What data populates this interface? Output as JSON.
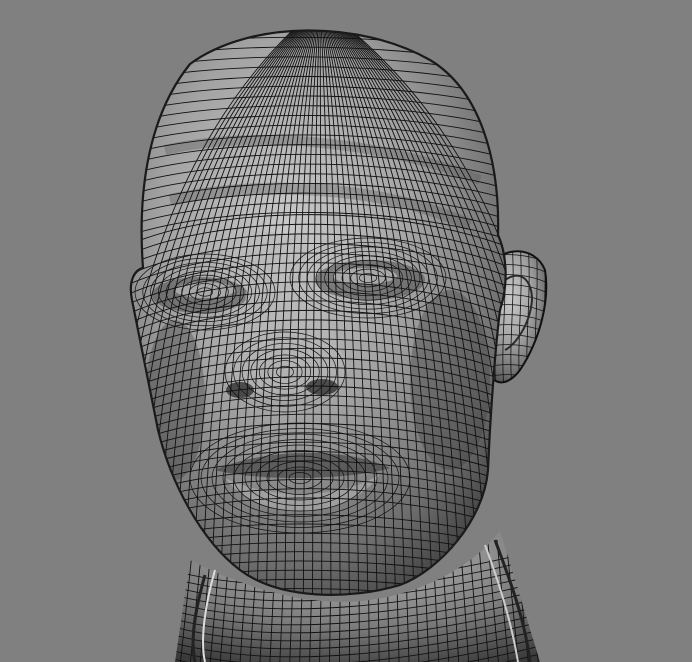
{
  "viewport": {
    "background_color": "#808080",
    "mesh_fill_color": "#9c9c9c",
    "mesh_highlight_color": "#c8c8c8",
    "mesh_shadow_color": "#3a3a3a",
    "wire_color": "#111111",
    "subject": "wireframe-head-sculpt"
  }
}
